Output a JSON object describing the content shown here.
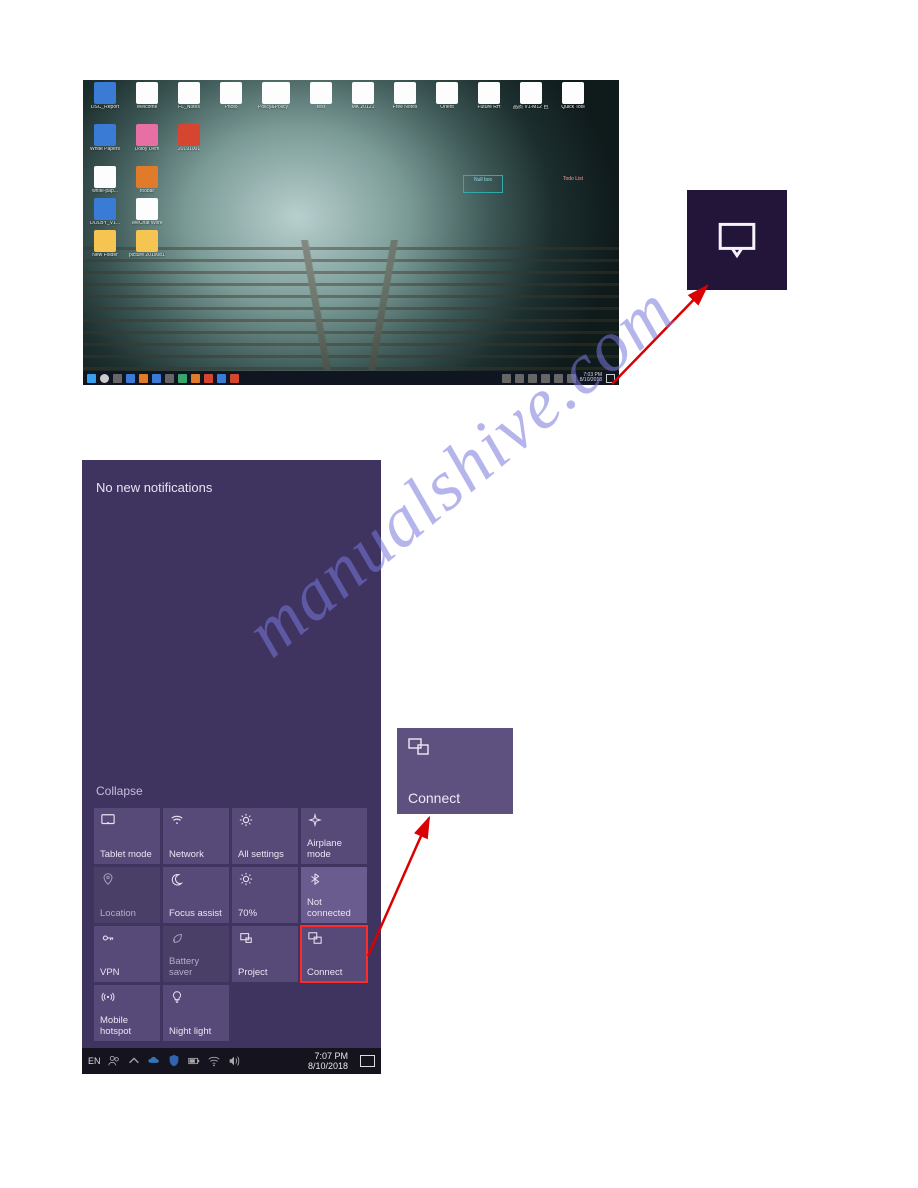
{
  "watermark": "manualshive.com",
  "desktop": {
    "icons_row1": [
      {
        "label": "DSC_Report"
      },
      {
        "label": "Welcome"
      },
      {
        "label": "FL_Notes"
      },
      {
        "label": "Photo"
      },
      {
        "label": "Policy&Policy"
      }
    ],
    "icons_row1b": [
      {
        "label": ""
      },
      {
        "label": "test"
      },
      {
        "label": "MK 20121"
      },
      {
        "label": "Free Notes"
      },
      {
        "label": "Orient"
      },
      {
        "label": "Future RH"
      },
      {
        "label": "品质 V1-M12\n自定项目"
      },
      {
        "label": "Quick Tool"
      }
    ],
    "icons_row2": [
      {
        "label": "White Papers"
      },
      {
        "label": "Dolby Dem"
      },
      {
        "label": "20191001"
      }
    ],
    "icons_row3": [
      {
        "label": "white-pap..."
      },
      {
        "label": "foobar"
      }
    ],
    "icons_row4": [
      {
        "label": "DOLBY_V1..."
      },
      {
        "label": "WeChat\nWork"
      }
    ],
    "icons_row5": [
      {
        "label": "New Folder"
      },
      {
        "label": "picture\n20190816"
      }
    ],
    "float1": "Null box",
    "float2": "Todo List",
    "taskbar_time": "7:03 PM",
    "taskbar_date": "8/10/2018"
  },
  "callout_icon_name": "notification-center-icon",
  "action_center": {
    "header": "No new notifications",
    "collapse": "Collapse",
    "quick_actions": [
      {
        "id": "tablet-mode",
        "icon": "tablet",
        "label": "Tablet mode",
        "style": ""
      },
      {
        "id": "network",
        "icon": "wifi",
        "label": "Network",
        "style": ""
      },
      {
        "id": "all-settings",
        "icon": "gear",
        "label": "All settings",
        "style": ""
      },
      {
        "id": "airplane-mode",
        "icon": "plane",
        "label": "Airplane mode",
        "style": ""
      },
      {
        "id": "location",
        "icon": "pin",
        "label": "Location",
        "style": "dim"
      },
      {
        "id": "focus-assist",
        "icon": "moon",
        "label": "Focus assist",
        "style": ""
      },
      {
        "id": "brightness",
        "icon": "sun",
        "label": "70%",
        "style": ""
      },
      {
        "id": "bluetooth",
        "icon": "bt",
        "label": "Not connected",
        "style": "lite"
      },
      {
        "id": "vpn",
        "icon": "key",
        "label": "VPN",
        "style": ""
      },
      {
        "id": "battery-saver",
        "icon": "leaf",
        "label": "Battery saver",
        "style": "dim"
      },
      {
        "id": "project",
        "icon": "project",
        "label": "Project",
        "style": ""
      },
      {
        "id": "connect",
        "icon": "connect",
        "label": "Connect",
        "style": "hl"
      },
      {
        "id": "mobile-hotspot",
        "icon": "hotspot",
        "label": "Mobile hotspot",
        "style": ""
      },
      {
        "id": "night-light",
        "icon": "bulb",
        "label": "Night light",
        "style": ""
      }
    ],
    "taskbar": {
      "lang": "EN",
      "time": "7:07 PM",
      "date": "8/10/2018"
    }
  },
  "connect_callout_label": "Connect"
}
